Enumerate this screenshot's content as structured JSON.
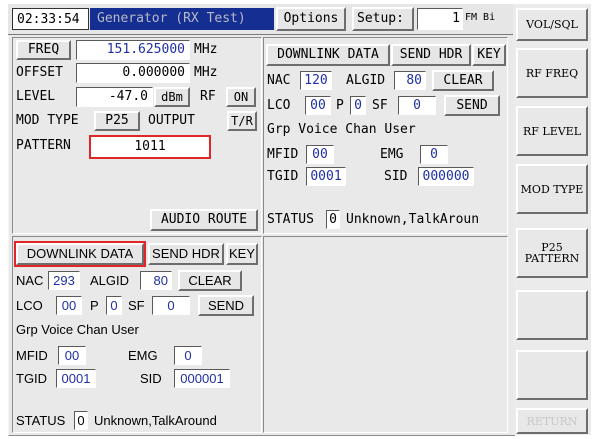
{
  "header": {
    "time": "02:33:54",
    "title": "Generator (RX Test)",
    "options_label": "Options",
    "setup_label": "Setup:",
    "setup_value": "1",
    "setup_mode": "FM Bi"
  },
  "generator": {
    "freq_label": "FREQ",
    "freq_value": "151.625000",
    "freq_unit": "MHz",
    "offset_label": "OFFSET",
    "offset_value": "0.000000",
    "offset_unit": "MHz",
    "level_label": "LEVEL",
    "level_value": "-47.0",
    "level_unit": "dBm",
    "rf_label": "RF",
    "rf_value": "ON",
    "modtype_label": "MOD TYPE",
    "modtype_value": "P25",
    "output_label": "OUTPUT",
    "output_value": "T/R",
    "pattern_label": "PATTERN",
    "pattern_value": "1011",
    "audio_route_label": "AUDIO ROUTE"
  },
  "dl_top": {
    "downlink_label": "DOWNLINK DATA",
    "send_hdr_label": "SEND HDR",
    "key_label": "KEY",
    "nac_label": "NAC",
    "nac_value": "120",
    "algid_label": "ALGID",
    "algid_value": "80",
    "clear_label": "CLEAR",
    "lco_label": "LCO",
    "lco_value": "00",
    "p_label": "P",
    "p_value": "0",
    "sf_label": "SF",
    "sf_value": "0",
    "send_label": "SEND",
    "grp_label": "Grp Voice Chan User",
    "mfid_label": "MFID",
    "mfid_value": "00",
    "emg_label": "EMG",
    "emg_value": "0",
    "tgid_label": "TGID",
    "tgid_value": "0001",
    "sid_label": "SID",
    "sid_value": "000000",
    "status_label": "STATUS",
    "status_value": "0",
    "status_text": "Unknown,TalkAroun"
  },
  "dl_bottom": {
    "downlink_label": "DOWNLINK DATA",
    "send_hdr_label": "SEND HDR",
    "key_label": "KEY",
    "nac_label": "NAC",
    "nac_value": "293",
    "algid_label": "ALGID",
    "algid_value": "80",
    "clear_label": "CLEAR",
    "lco_label": "LCO",
    "lco_value": "00",
    "p_label": "P",
    "p_value": "0",
    "sf_label": "SF",
    "sf_value": "0",
    "send_label": "SEND",
    "grp_label": "Grp Voice Chan User",
    "mfid_label": "MFID",
    "mfid_value": "00",
    "emg_label": "EMG",
    "emg_value": "0",
    "tgid_label": "TGID",
    "tgid_value": "0001",
    "sid_label": "SID",
    "sid_value": "000001",
    "status_label": "STATUS",
    "status_value": "0",
    "status_text": "Unknown,TalkAround"
  },
  "softkeys": {
    "k1": "VOL/SQL",
    "k2": "RF FREQ",
    "k3": "RF LEVEL",
    "k4": "MOD TYPE",
    "k5": "P25\nPATTERN",
    "k6": "",
    "k7": "",
    "k8": "RETURN"
  },
  "colors": {
    "title_bar": "#142e91",
    "value_text": "#1f2fa6",
    "highlight": "#e02626"
  }
}
